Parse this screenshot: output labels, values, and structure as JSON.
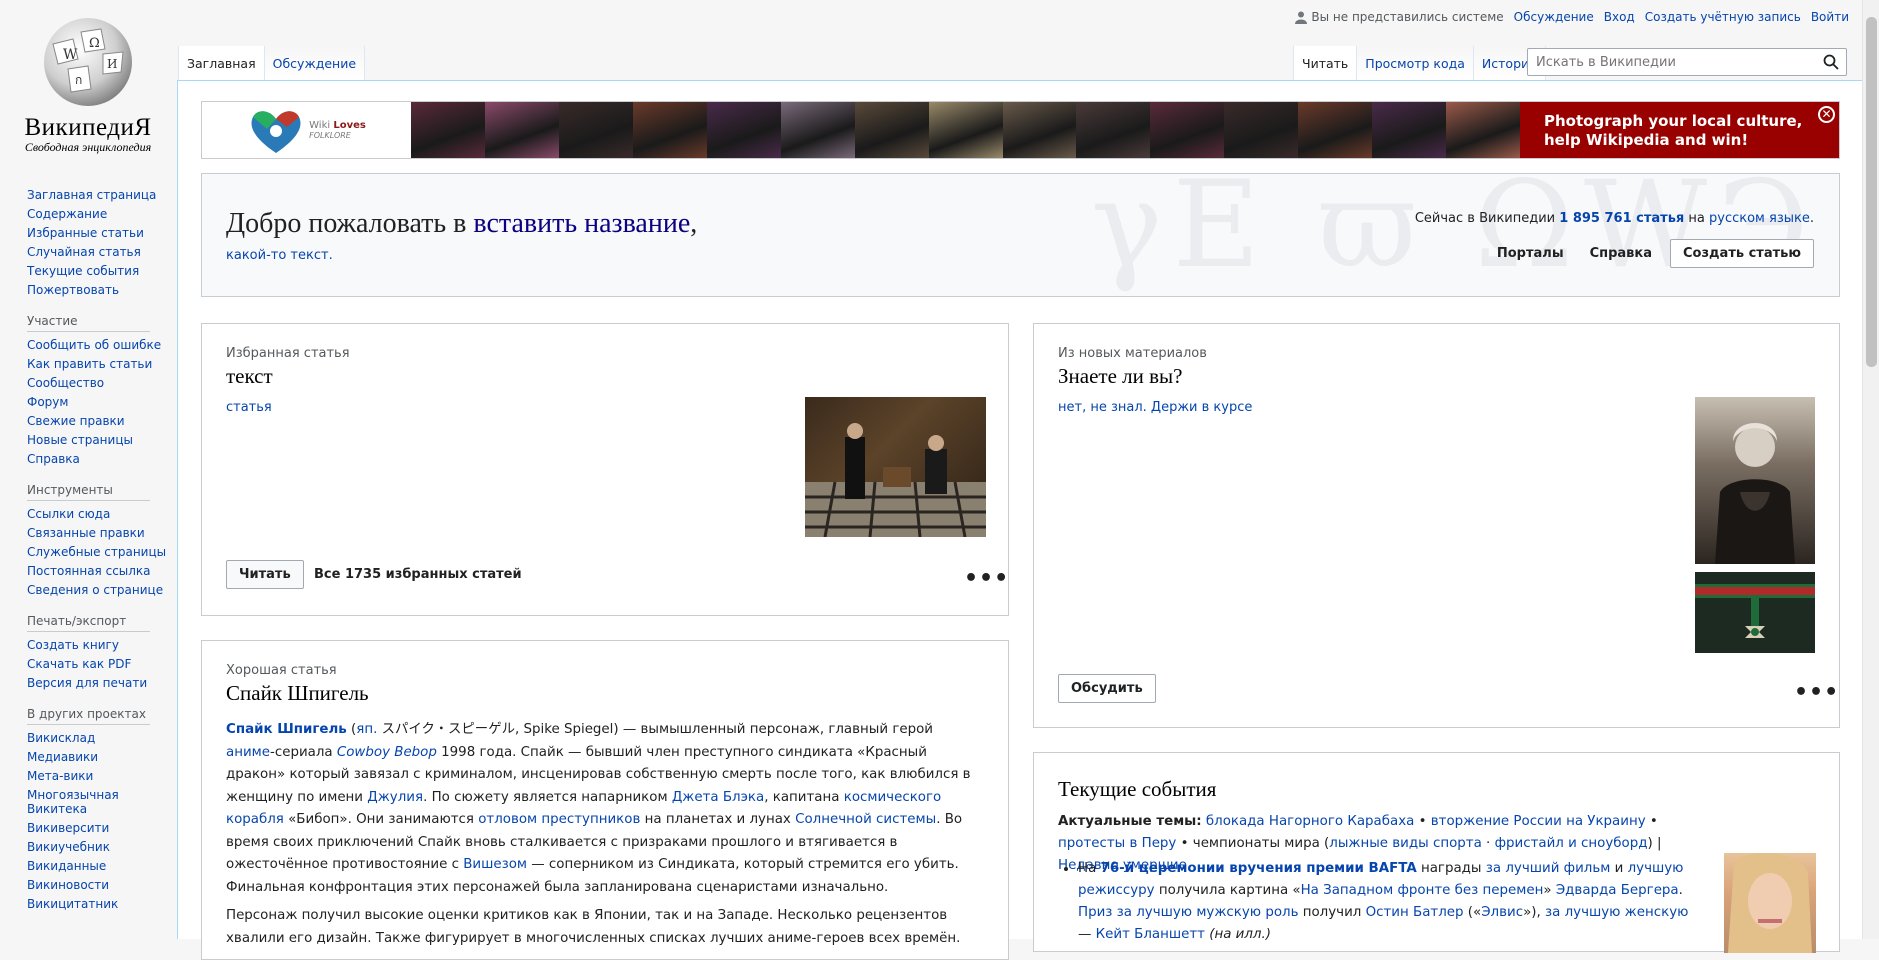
{
  "logo": {
    "wordmark": "ВикипедиЯ",
    "tagline": "Свободная энциклопедия"
  },
  "sidebar": {
    "nav": [
      "Заглавная страница",
      "Содержание",
      "Избранные статьи",
      "Случайная статья",
      "Текущие события",
      "Пожертвовать"
    ],
    "sections": [
      {
        "title": "Участие",
        "items": [
          "Сообщить об ошибке",
          "Как править статьи",
          "Сообщество",
          "Форум",
          "Свежие правки",
          "Новые страницы",
          "Справка"
        ]
      },
      {
        "title": "Инструменты",
        "items": [
          "Ссылки сюда",
          "Связанные правки",
          "Служебные страницы",
          "Постоянная ссылка",
          "Сведения о странице"
        ]
      },
      {
        "title": "Печать/экспорт",
        "items": [
          "Создать книгу",
          "Скачать как PDF",
          "Версия для печати"
        ]
      },
      {
        "title": "В других проектах",
        "items": [
          "Викисклад",
          "Медиавики",
          "Мета-вики",
          "Многоязычная Викитека",
          "Викиверсити",
          "Викиучебник",
          "Викиданные",
          "Викиновости",
          "Викицитатник"
        ]
      }
    ]
  },
  "personal": {
    "anon": "Вы не представились системе",
    "links": [
      "Обсуждение",
      "Вход",
      "Создать учётную запись",
      "Войти"
    ]
  },
  "tabs": {
    "left": [
      {
        "label": "Заглавная",
        "selected": true
      },
      {
        "label": "Обсуждение",
        "selected": false
      }
    ],
    "right": [
      {
        "label": "Читать",
        "selected": true
      },
      {
        "label": "Просмотр кода",
        "selected": false
      },
      {
        "label": "История",
        "selected": false
      }
    ]
  },
  "search": {
    "placeholder": "Искать в Википедии"
  },
  "banner": {
    "logo_line1": "Wiki",
    "logo_loves": "Loves",
    "logo_line2": "FOLKLORE",
    "cta": "Photograph your local culture, help Wikipedia and win!",
    "photo_colors": [
      "#5a2a3a",
      "#8a4a6a",
      "#3a2a2a",
      "#6a3a2a",
      "#4a2a4a",
      "#7a6a7a",
      "#5a4a3a",
      "#9a8a6a",
      "#6a5a4a",
      "#4a3a3a",
      "#5a2a3a",
      "#3a2a2a",
      "#6a3a2a",
      "#4a2a4a",
      "#9a5a4a"
    ]
  },
  "welcome": {
    "prefix": "Добро пожаловать в ",
    "link": "вставить название",
    "suffix": ",",
    "sub": "какой-то текст.",
    "count_prefix": "Сейчас в Википедии ",
    "count": "1 895 761 статья",
    "count_mid": " на ",
    "count_lang": "русском языке",
    "count_end": ".",
    "portals": "Порталы",
    "help": "Справка",
    "create": "Создать статью"
  },
  "featured": {
    "kicker": "Избранная статья",
    "title": "текст",
    "link": "статья",
    "read": "Читать",
    "all": "Все 1735 избранных статей"
  },
  "good": {
    "kicker": "Хорошая статья",
    "title": "Спайк Шпигель",
    "p1": {
      "name": "Спайк Шпигель",
      "lang": "яп.",
      "jp": " スパイク・スピーゲル, Spike Spiegel) — вымышленный персонаж, главный герой ",
      "anime": "аниме",
      "t1": "-сериала ",
      "cb": "Cowboy Bebop",
      "t2": " 1998 года. Спайк — бывший член преступного синдиката «Красный дракон» который завязал с криминалом, инсценировав собственную смерть после того, как влюбился в женщину по имени ",
      "julia": "Джулия",
      "t3": ". По сюжету является напарником ",
      "jet": "Джета Блэка",
      "t4": ", капитана ",
      "ship": "космического корабля",
      "t5": " «Бибоп». Они занимаются ",
      "hunt": "отловом преступников",
      "t6": " на планетах и лунах ",
      "sol": "Солнечной системы",
      "t7": ". Во время своих приключений Спайк вновь сталкивается с призраками прошлого и втягивается в ожесточённое противостояние с ",
      "vic": "Вишезом",
      "t8": " — соперником из Синдиката, который стремится его убить. Финальная конфронтация этих персонажей была запланирована сценаристами изначально."
    },
    "p2": "Персонаж получил высокие оценки критиков как в Японии, так и на Западе. Несколько рецензентов хвалили его дизайн. Также фигурирует в многочисленных списках лучших аниме-героев всех времён."
  },
  "dyk": {
    "kicker": "Из новых материалов",
    "title": "Знаете ли вы?",
    "link": "нет, не знал. Держи в курсе",
    "discuss": "Обсудить"
  },
  "news": {
    "title": "Текущие события",
    "topics_label": "Актуальные темы:",
    "topic1": "блокада Нагорного Карабаха",
    "topic2": "вторжение России на Украину",
    "topic3": "протесты в Перу",
    "topic4_text": "чемпионаты мира (",
    "topic5": "лыжные виды спорта",
    "topic6": "фристайл и сноуборд",
    "topic7": "Недавно умершие",
    "i1_pre": "На ",
    "i1_bafta": "76-й церемонии вручения премии BAFTA",
    "i1_t1": " награды ",
    "i1_film": "за лучший фильм",
    "i1_t2": " и ",
    "i1_dir": "лучшую режиссуру",
    "i1_t3": " получила картина «",
    "i1_movie": "На Западном фронте без перемен",
    "i1_t4": "» ",
    "i1_berger": "Эдварда Бергера",
    "i1_t5": ". ",
    "i1_actor": "Приз за лучшую мужскую роль",
    "i1_t6": " получил ",
    "i1_butler": "Остин Батлер",
    "i1_t7": " («",
    "i1_elvis": "Элвис",
    "i1_t8": "»), ",
    "i1_actress": "за лучшую женскую",
    "i1_t9": " — ",
    "i1_blanchett": "Кейт Бланшетт",
    "i1_t10": " (на илл.)"
  },
  "colors": {
    "link": "#0645ad",
    "banner_red": "#990000",
    "border": "#c8ccd1"
  }
}
